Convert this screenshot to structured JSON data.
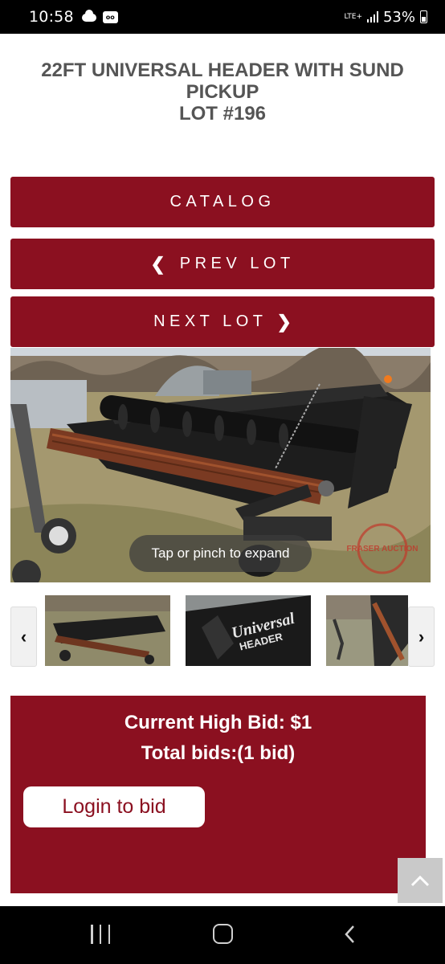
{
  "status_bar": {
    "time": "10:58",
    "network": "LTE+",
    "battery": "53%",
    "icons": [
      "cloud-icon",
      "voicemail-icon",
      "signal-icon",
      "battery-icon"
    ]
  },
  "lot": {
    "title_line1": "22FT UNIVERSAL HEADER WITH SUND",
    "title_line2": "PICKUP",
    "title_line3": "LOT #196"
  },
  "nav": {
    "catalog": "CATALOG",
    "prev": "PREV LOT",
    "next": "NEXT LOT"
  },
  "gallery": {
    "expand_hint": "Tap or pinch to expand",
    "watermark": "FRASER AUCTION",
    "thumb2_logo_line1": "Universal",
    "thumb2_logo_line2": "HEADER"
  },
  "bid": {
    "current_high_bid": "Current High Bid: $1",
    "total_bids": "Total bids:(1 bid)",
    "login_label": "Login to bid"
  },
  "colors": {
    "brand_red": "#8b1020",
    "status_bar": "#000000"
  }
}
